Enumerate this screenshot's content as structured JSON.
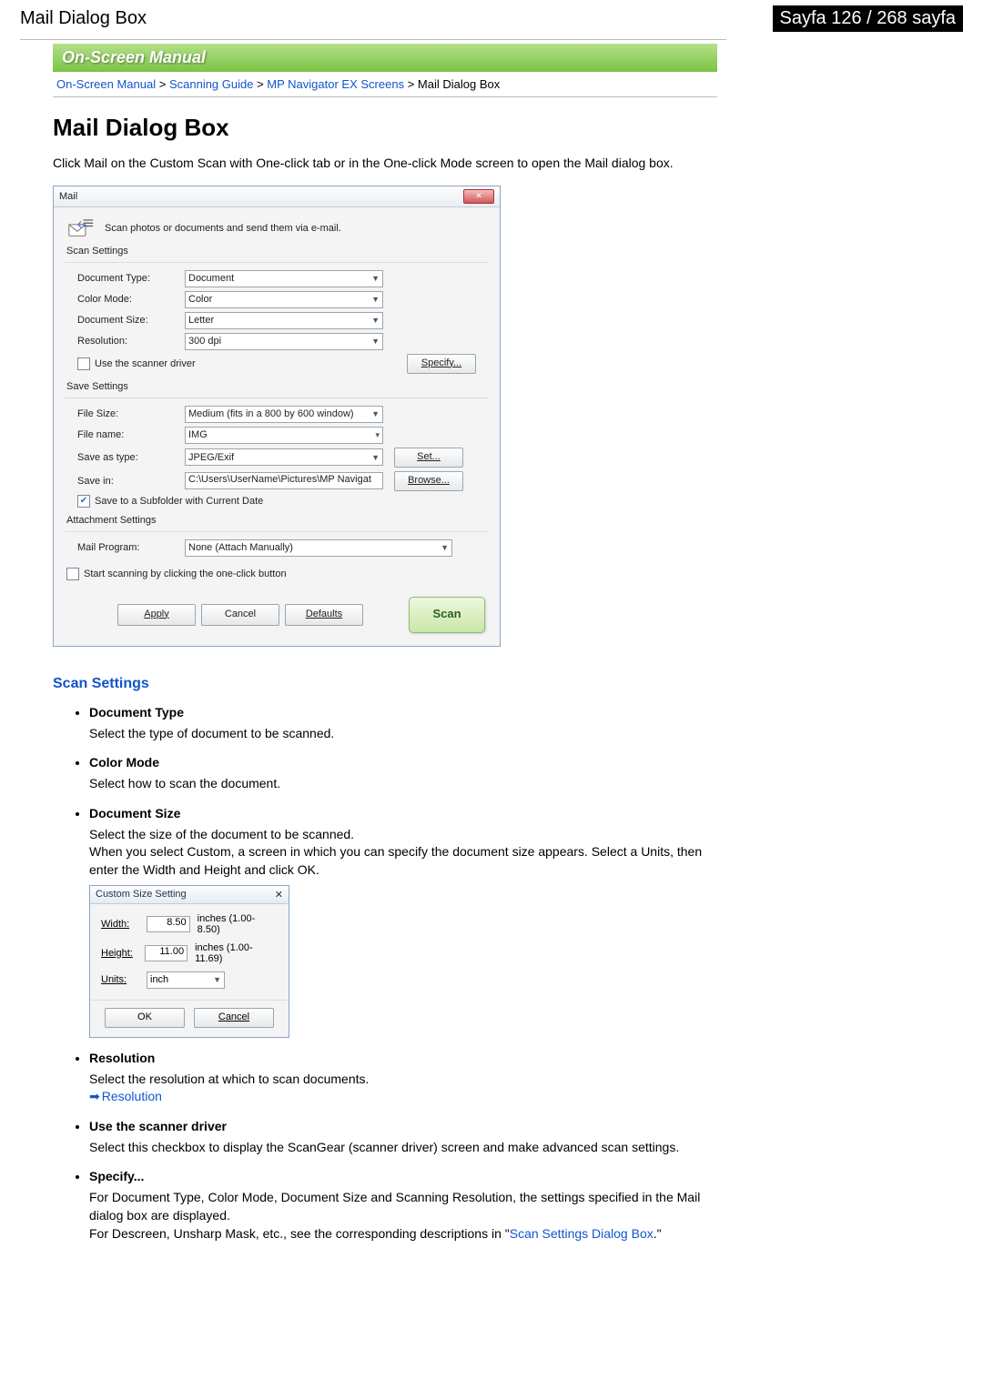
{
  "header": {
    "left": "Mail Dialog Box",
    "right": "Sayfa 126 / 268 sayfa"
  },
  "band": "On-Screen Manual",
  "crumbs": {
    "a": "On-Screen Manual",
    "b": "Scanning Guide",
    "c": "MP Navigator EX Screens",
    "d": "Mail Dialog Box",
    "sep": " > "
  },
  "h1": "Mail Dialog Box",
  "intro": "Click Mail on the Custom Scan with One-click tab or in the One-click Mode screen to open the Mail dialog box.",
  "dlg": {
    "title": "Mail",
    "tagline": "Scan photos or documents and send them via e-mail.",
    "scanSettings": "Scan Settings",
    "docType": {
      "l": "Document Type:",
      "v": "Document"
    },
    "colorMode": {
      "l": "Color Mode:",
      "v": "Color"
    },
    "docSize": {
      "l": "Document Size:",
      "v": "Letter"
    },
    "resolution": {
      "l": "Resolution:",
      "v": "300 dpi"
    },
    "useDriver": "Use the scanner driver",
    "specify": "Specify...",
    "saveSettings": "Save Settings",
    "fileSize": {
      "l": "File Size:",
      "v": "Medium (fits in a 800 by 600 window)"
    },
    "fileName": {
      "l": "File name:",
      "v": "IMG"
    },
    "saveAs": {
      "l": "Save as type:",
      "v": "JPEG/Exif"
    },
    "setBtn": "Set...",
    "saveIn": {
      "l": "Save in:",
      "v": "C:\\Users\\UserName\\Pictures\\MP Navigat"
    },
    "browse": "Browse...",
    "subfolder": "Save to a Subfolder with Current Date",
    "attachSettings": "Attachment Settings",
    "mailProg": {
      "l": "Mail Program:",
      "v": "None (Attach Manually)"
    },
    "startScanning": "Start scanning by clicking the one-click button",
    "apply": "Apply",
    "cancel": "Cancel",
    "defaults": "Defaults",
    "scan": "Scan"
  },
  "h2": "Scan Settings",
  "list": {
    "docType": {
      "t": "Document Type",
      "d": "Select the type of document to be scanned."
    },
    "colorMode": {
      "t": "Color Mode",
      "d": "Select how to scan the document."
    },
    "docSize": {
      "t": "Document Size",
      "d1": "Select the size of the document to be scanned.",
      "d2": "When you select Custom, a screen in which you can specify the document size appears. Select a Units, then enter the Width and Height and click OK."
    },
    "resolution": {
      "t": "Resolution",
      "d": "Select the resolution at which to scan documents.",
      "link": "Resolution"
    },
    "useDriver": {
      "t": "Use the scanner driver",
      "d": "Select this checkbox to display the ScanGear (scanner driver) screen and make advanced scan settings."
    },
    "specify": {
      "t": "Specify...",
      "d1": "For Document Type, Color Mode, Document Size and Scanning Resolution, the settings specified in the Mail dialog box are displayed.",
      "d2a": "For Descreen, Unsharp Mask, etc., see the corresponding descriptions in \"",
      "link": "Scan Settings Dialog Box",
      "d2b": ".\""
    }
  },
  "csw": {
    "title": "Custom Size Setting",
    "width": {
      "l": "Width:",
      "v": "8.50",
      "r": "inches (1.00-8.50)"
    },
    "height": {
      "l": "Height:",
      "v": "11.00",
      "r": "inches (1.00-11.69)"
    },
    "units": {
      "l": "Units:",
      "v": "inch"
    },
    "ok": "OK",
    "cancel": "Cancel"
  }
}
